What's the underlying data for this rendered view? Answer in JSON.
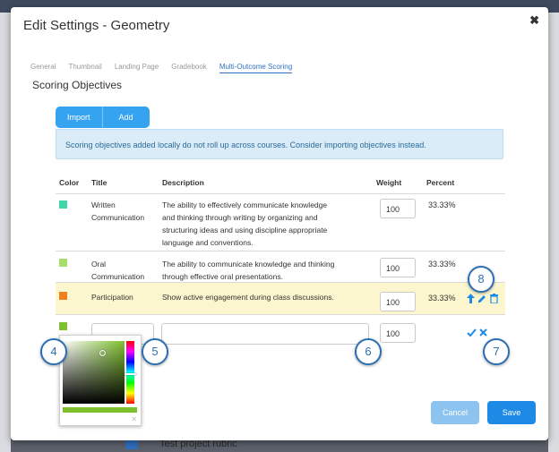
{
  "modal": {
    "title": "Edit Settings - Geometry"
  },
  "tabs": [
    {
      "label": "General"
    },
    {
      "label": "Thumbnail"
    },
    {
      "label": "Landing Page"
    },
    {
      "label": "Gradebook"
    },
    {
      "label": "Multi-Outcome Scoring"
    }
  ],
  "section_title": "Scoring Objectives",
  "buttons": {
    "import": "Import",
    "add": "Add",
    "cancel": "Cancel",
    "save": "Save"
  },
  "info_message": "Scoring objectives added locally do not roll up across courses. Consider importing objectives instead.",
  "table": {
    "headers": {
      "color": "Color",
      "title": "Title",
      "description": "Description",
      "weight": "Weight",
      "percent": "Percent"
    },
    "rows": [
      {
        "color": "#3fd6a8",
        "title_line1": "Written",
        "title_line2": "Communication",
        "desc_line1": "The ability to effectively communicate knowledge",
        "desc_line2": "and thinking through writing by organizing and",
        "desc_line3": "structuring ideas and using discipline appropriate",
        "desc_line4": "language and conventions.",
        "weight": "100",
        "percent": "33.33%"
      },
      {
        "color": "#a6e06a",
        "title_line1": "Oral",
        "title_line2": "Communication",
        "desc_line1": "The ability to communicate knowledge and thinking",
        "desc_line2": "through effective oral presentations.",
        "weight": "100",
        "percent": "33.33%"
      },
      {
        "color": "#f07f20",
        "title_line1": "Participation",
        "desc_line1": "Show active engagement during class discussions.",
        "weight": "100",
        "percent": "33.33%"
      }
    ],
    "new_row": {
      "color": "#7fc02f",
      "weight": "100"
    }
  },
  "callouts": {
    "c4": "4",
    "c5": "5",
    "c6": "6",
    "c7": "7",
    "c8": "8"
  },
  "colors": {
    "primary": "#1e8ae6",
    "accent": "#36a3f0",
    "highlight": "#fbf6cd",
    "callout": "#2c6fb2"
  },
  "background": {
    "item_text": "Test project rubric"
  }
}
